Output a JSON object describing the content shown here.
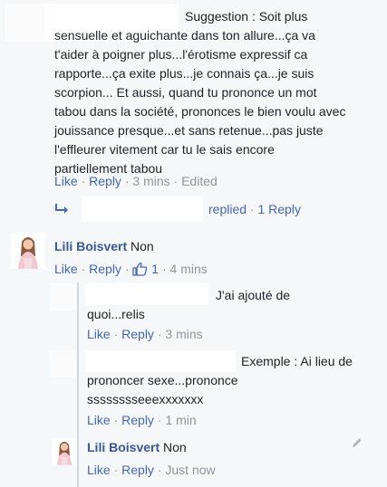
{
  "comment1": {
    "lines": [
      "Suggestion : Soit plus",
      "sensuelle et aguichante dans ton allure...ça va",
      "t'aider à poigner plus...l'érotisme expressif ca",
      "rapporte...ça exite plus...je connais ça...je suis",
      "scorpion... Et aussi, quand tu prononce un mot",
      "tabou dans la société, prononces le bien voulu avec",
      "jouissance presque...et sans retenue...pas juste",
      "l'effleurer vitement car tu le sais encore",
      "partiellement tabou"
    ],
    "like": "Like",
    "reply": "Reply",
    "time": "3 mins",
    "edited": "Edited"
  },
  "replies_summary": {
    "replied": "replied",
    "count": "1 Reply"
  },
  "comment2": {
    "author": "Lili Boisvert",
    "text": "Non",
    "like": "Like",
    "reply": "Reply",
    "reactions": "1",
    "time": "4 mins"
  },
  "reply1": {
    "lines": [
      "J'ai ajouté de",
      "quoi...relis"
    ],
    "like": "Like",
    "reply": "Reply",
    "time": "3 mins"
  },
  "reply2": {
    "lines": [
      "Exemple : Ai lieu de",
      "prononcer sexe...prononce",
      "sssssssseeexxxxxxx"
    ],
    "like": "Like",
    "reply": "Reply",
    "time": "1 min"
  },
  "reply3": {
    "author": "Lili Boisvert",
    "text": "Non",
    "like": "Like",
    "reply": "Reply",
    "time": "Just now"
  },
  "icons": {
    "reply_arrow": "reply-arrow-icon",
    "thumbs_up": "thumbs-up-icon",
    "pencil": "pencil-icon"
  },
  "colors": {
    "link": "#4267b2",
    "name": "#365899",
    "meta": "#90949c",
    "background": "#f6f7f9"
  }
}
